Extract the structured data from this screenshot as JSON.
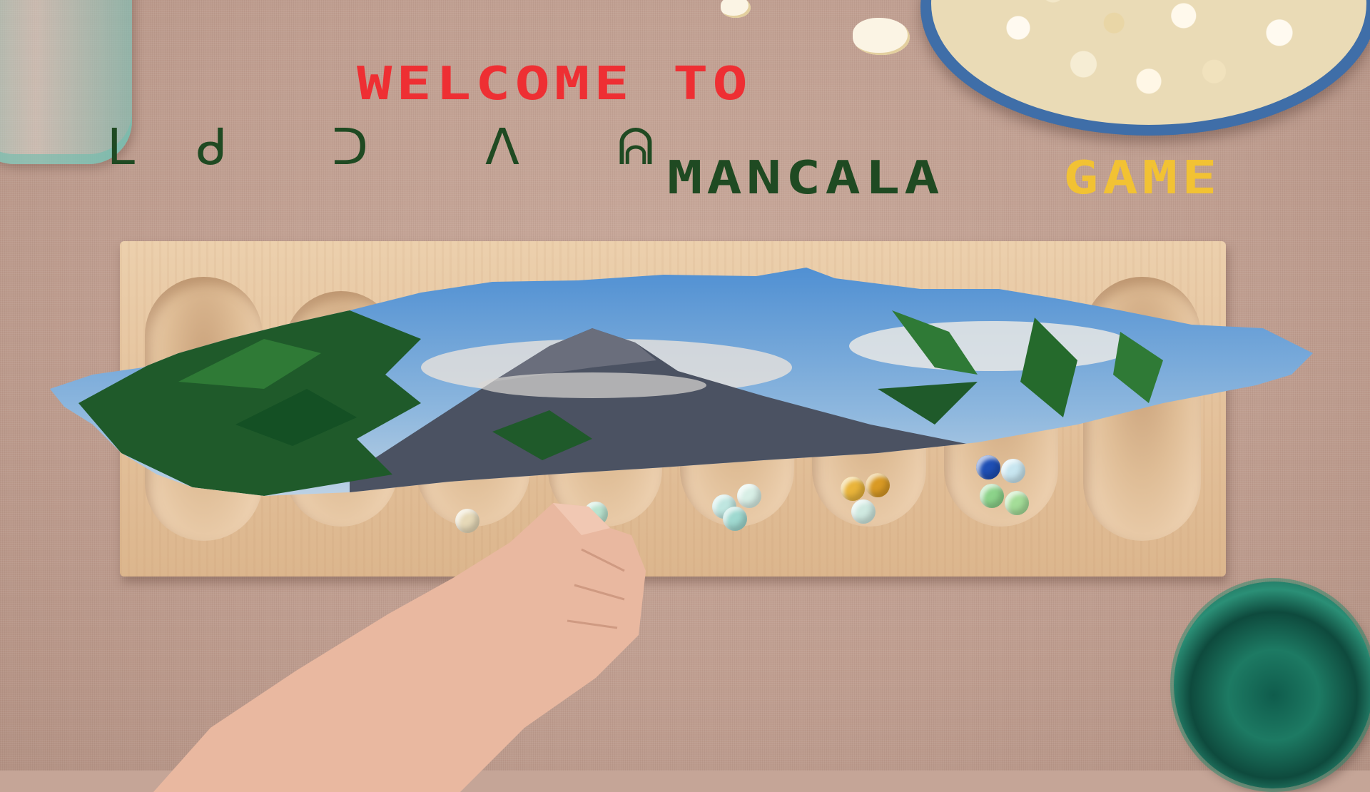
{
  "title": {
    "line1": "WELCOME TO",
    "line2_word1": "MANCALA",
    "line2_word2": "GAME",
    "decorative_glyphs": [
      "ᒪ",
      "ᑯ",
      "ᑐ",
      "ᐱ",
      "ᕱ"
    ]
  },
  "colors": {
    "welcome": "#ee2f33",
    "mancala": "#1f4a22",
    "game": "#f2c233",
    "background_fabric": "#c5a597",
    "board_wood": "#e4c29c",
    "bowl": "#3f6ea8"
  },
  "scene": {
    "board": {
      "pits_per_row": 6,
      "stores": 2
    },
    "objects": [
      "popcorn-bowl",
      "water-glass",
      "green-glass",
      "hand",
      "mountain-landscape"
    ]
  }
}
